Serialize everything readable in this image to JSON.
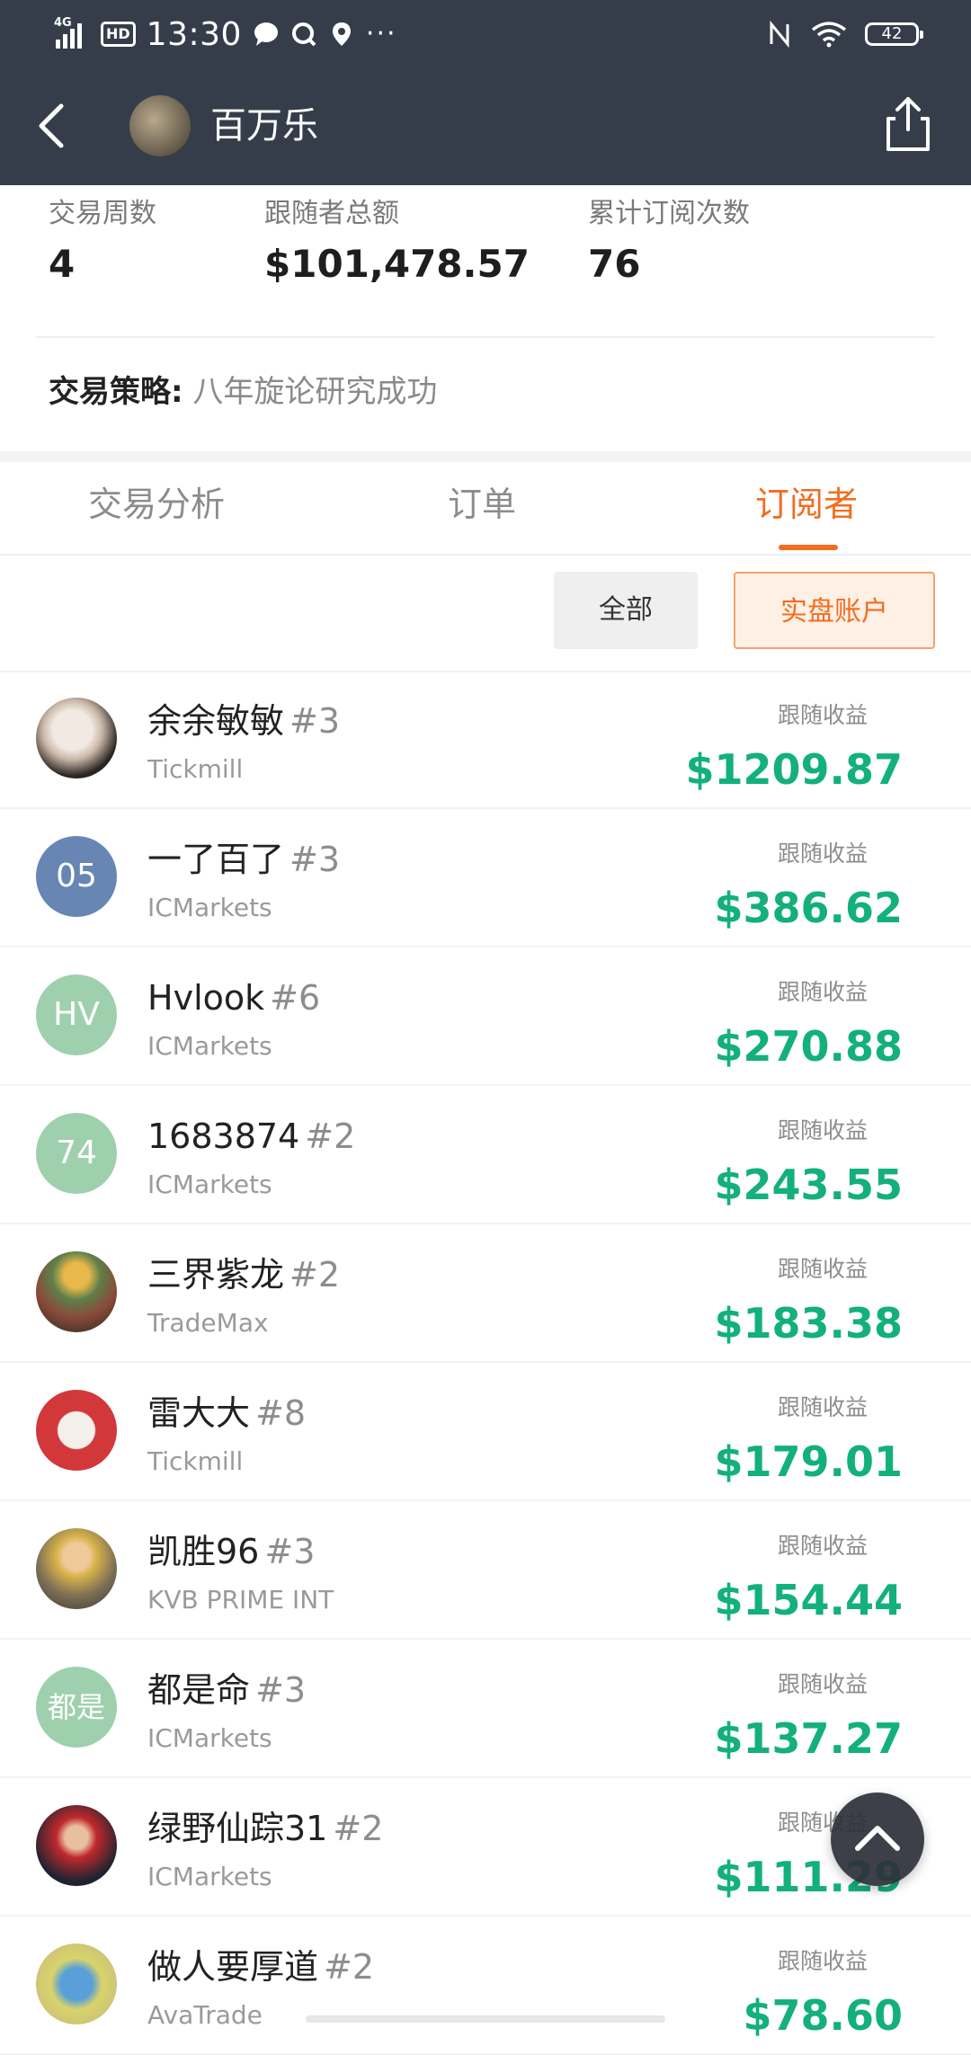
{
  "status_bar": {
    "network": "4G",
    "hd": "HD",
    "time": "13:30",
    "more": "···",
    "battery": "42"
  },
  "nav": {
    "title": "百万乐"
  },
  "stats": [
    {
      "label": "交易周数",
      "value": "4"
    },
    {
      "label": "跟随者总额",
      "value": "$101,478.57"
    },
    {
      "label": "累计订阅次数",
      "value": "76"
    }
  ],
  "strategy": {
    "key": "交易策略:",
    "value": "八年旋论研究成功"
  },
  "tabs": [
    {
      "label": "交易分析",
      "active": false
    },
    {
      "label": "订单",
      "active": false
    },
    {
      "label": "订阅者",
      "active": true
    }
  ],
  "filters": {
    "all": "全部",
    "live": "实盘账户"
  },
  "profit_label": "跟随收益",
  "subscribers": [
    {
      "name": "余余敏敏",
      "rank": "#3",
      "broker": "Tickmill",
      "profit": "$1209.87",
      "avatar_text": "",
      "avatar_color": "#e9e2dc"
    },
    {
      "name": "一了百了",
      "rank": "#3",
      "broker": "ICMarkets",
      "profit": "$386.62",
      "avatar_text": "05",
      "avatar_color": "#6786b4"
    },
    {
      "name": "Hvlook",
      "rank": "#6",
      "broker": "ICMarkets",
      "profit": "$270.88",
      "avatar_text": "HV",
      "avatar_color": "#9fd0ad"
    },
    {
      "name": "1683874",
      "rank": "#2",
      "broker": "ICMarkets",
      "profit": "$243.55",
      "avatar_text": "74",
      "avatar_color": "#9fd0ad"
    },
    {
      "name": "三界紫龙",
      "rank": "#2",
      "broker": "TradeMax",
      "profit": "$183.38",
      "avatar_text": "",
      "avatar_color": "#7d5a3c"
    },
    {
      "name": "雷大大",
      "rank": "#8",
      "broker": "Tickmill",
      "profit": "$179.01",
      "avatar_text": "",
      "avatar_color": "#d2383a"
    },
    {
      "name": "凯胜96",
      "rank": "#3",
      "broker": "KVB PRIME INT",
      "profit": "$154.44",
      "avatar_text": "",
      "avatar_color": "#b7a57d"
    },
    {
      "name": "都是命",
      "rank": "#3",
      "broker": "ICMarkets",
      "profit": "$137.27",
      "avatar_text": "都是",
      "avatar_color": "#9fd0ad"
    },
    {
      "name": "绿野仙踪31",
      "rank": "#2",
      "broker": "ICMarkets",
      "profit": "$111.29",
      "avatar_text": "",
      "avatar_color": "#1f2430"
    },
    {
      "name": "做人要厚道",
      "rank": "#2",
      "broker": "AvaTrade",
      "profit": "$78.60",
      "avatar_text": "",
      "avatar_color": "#c9d66e"
    }
  ]
}
